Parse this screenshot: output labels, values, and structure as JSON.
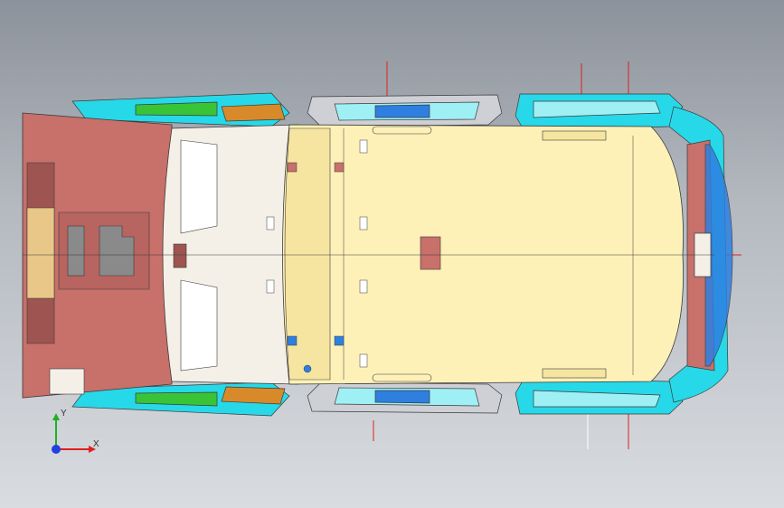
{
  "viewport": {
    "background_top": "#8c929b",
    "background_bottom": "#d9dce0"
  },
  "model": {
    "colors": {
      "roof": "#fdf1b8",
      "roof_shade": "#f6e5a0",
      "front_body": "#c8706a",
      "front_body_dark": "#9e5450",
      "windshield": "#f4f0e8",
      "cyan_panel": "#27d8e8",
      "cyan_light": "#9ff0f4",
      "green_part": "#39c437",
      "orange_part": "#d88a2a",
      "blue_part": "#2e7fe0",
      "grey_part": "#cfcfd6",
      "line": "#3a3a3a",
      "marker_red": "#e02020"
    }
  },
  "triad": {
    "x_label": "X",
    "y_label": "Y",
    "x_color": "#e02020",
    "y_color": "#20b020",
    "z_color": "#2040e0"
  }
}
